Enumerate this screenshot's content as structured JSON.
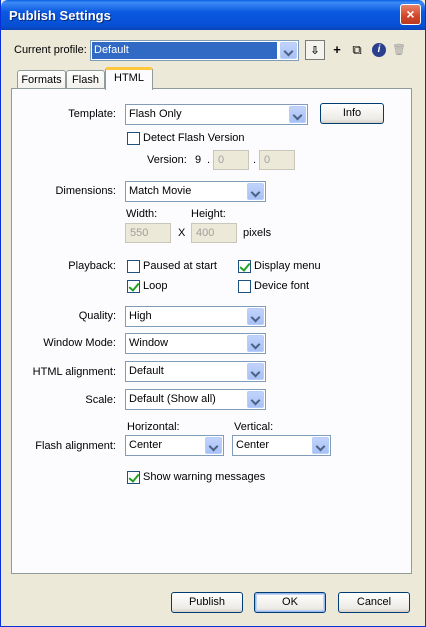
{
  "window": {
    "title": "Publish Settings",
    "close_icon": "×"
  },
  "profile": {
    "label": "Current profile:",
    "value": "Default",
    "tools": {
      "import_export": "⇩",
      "add": "+",
      "duplicate": "⧉",
      "info": "i",
      "delete": "🗑"
    }
  },
  "tabs": [
    {
      "label": "Formats"
    },
    {
      "label": "Flash"
    },
    {
      "label": "HTML"
    }
  ],
  "html_tab": {
    "template": {
      "label": "Template:",
      "value": "Flash Only",
      "info_button": "Info"
    },
    "detect_flash": {
      "label": "Detect Flash Version",
      "checked": false
    },
    "version": {
      "label": "Version:",
      "major": "9",
      "dot1": ".",
      "minor": "0",
      "dot2": ".",
      "revision": "0"
    },
    "dimensions": {
      "label": "Dimensions:",
      "value": "Match Movie",
      "width_label": "Width:",
      "height_label": "Height:",
      "width": "550",
      "x": "X",
      "height": "400",
      "units": "pixels"
    },
    "playback": {
      "label": "Playback:",
      "paused_at_start": {
        "label": "Paused at start",
        "checked": false
      },
      "display_menu": {
        "label": "Display menu",
        "checked": true
      },
      "loop": {
        "label": "Loop",
        "checked": true
      },
      "device_font": {
        "label": "Device font",
        "checked": false
      }
    },
    "quality": {
      "label": "Quality:",
      "value": "High"
    },
    "window_mode": {
      "label": "Window Mode:",
      "value": "Window"
    },
    "html_alignment": {
      "label": "HTML alignment:",
      "value": "Default"
    },
    "scale": {
      "label": "Scale:",
      "value": "Default (Show all)"
    },
    "flash_alignment": {
      "label": "Flash alignment:",
      "horizontal_label": "Horizontal:",
      "horizontal": "Center",
      "vertical_label": "Vertical:",
      "vertical": "Center"
    },
    "show_warnings": {
      "label": "Show warning messages",
      "checked": true
    }
  },
  "footer": {
    "publish": "Publish",
    "ok": "OK",
    "cancel": "Cancel"
  },
  "colors": {
    "titlebar": "#0650d4",
    "selection": "#316ac5",
    "dialog_bg": "#ece9d8",
    "active_tab_accent": "#ffc83c"
  }
}
